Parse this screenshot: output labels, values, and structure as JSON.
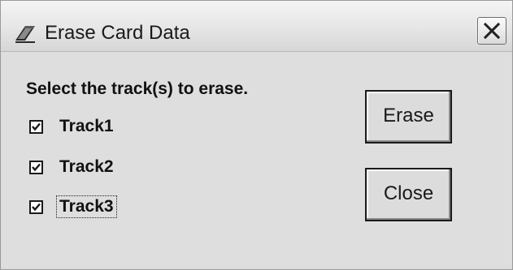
{
  "window": {
    "title": "Erase Card Data",
    "app_icon": "eraser-icon",
    "close_icon": "close-icon"
  },
  "dialog": {
    "instructions": "Select the track(s) to erase.",
    "tracks": [
      {
        "label": "Track1",
        "checked": true
      },
      {
        "label": "Track2",
        "checked": true
      },
      {
        "label": "Track3",
        "checked": true,
        "focused": true
      }
    ],
    "buttons": {
      "erase_label": "Erase",
      "close_label": "Close"
    }
  },
  "colors": {
    "dialog_background": "#dcdcdc",
    "text": "#111111",
    "check_mark": "#1a1a1a"
  }
}
